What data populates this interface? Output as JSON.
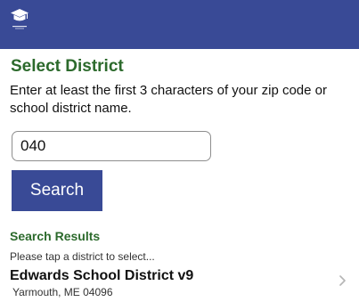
{
  "app": {
    "logo_icon": "graduation-cap-icon",
    "header_color": "#394a96",
    "accent_green": "#2c6a2c"
  },
  "page": {
    "title": "Select District",
    "instructions": "Enter at least the first 3 characters of your zip code or school district name."
  },
  "search": {
    "value": "040",
    "button_label": "Search"
  },
  "results": {
    "heading": "Search Results",
    "hint": "Please tap a district to select...",
    "items": [
      {
        "name": "Edwards School District v9",
        "address": "Yarmouth, ME 04096",
        "chevron_icon": "chevron-right-icon"
      }
    ]
  }
}
